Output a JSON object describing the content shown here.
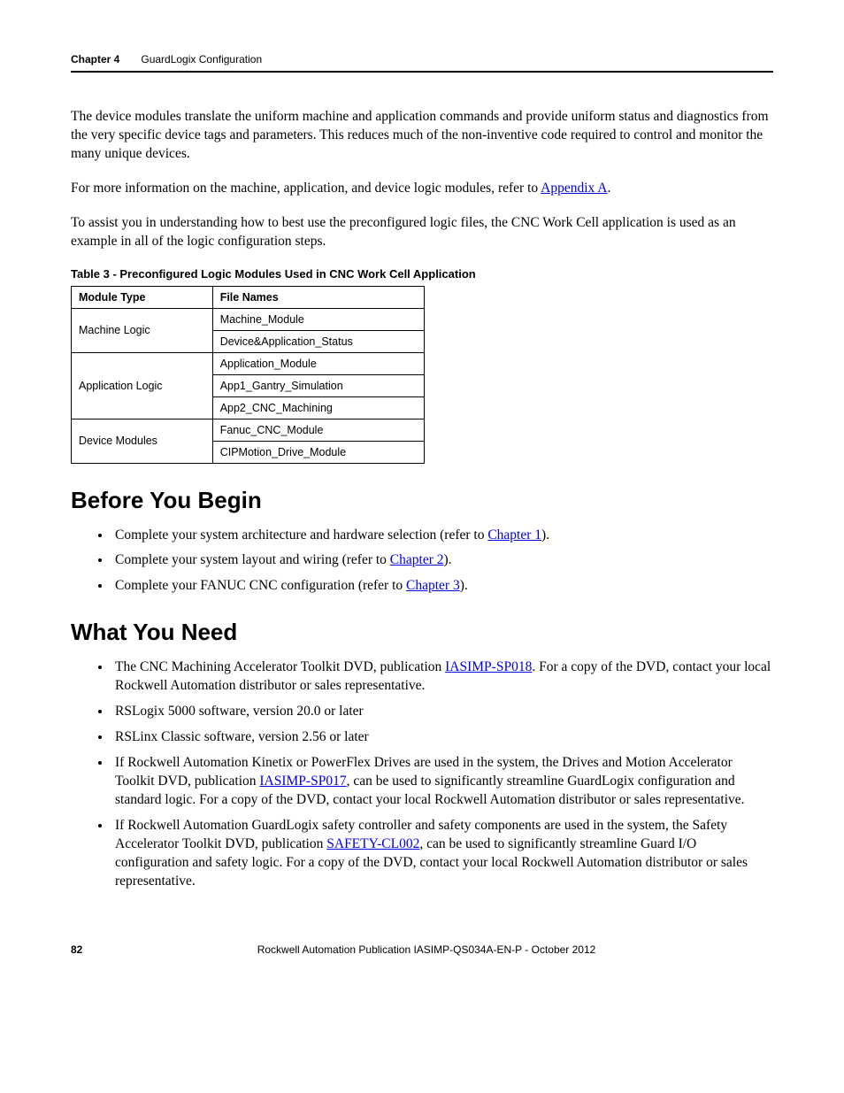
{
  "header": {
    "chapter": "Chapter 4",
    "title": "GuardLogix Configuration"
  },
  "paragraphs": {
    "p1": "The device modules translate the uniform machine and application commands and provide uniform status and diagnostics from the very specific device tags and parameters. This reduces much of the non-inventive code required to control and monitor the many unique devices.",
    "p2_pre": "For more information on the machine, application, and device logic modules, refer to ",
    "p2_link": "Appendix A",
    "p2_post": ".",
    "p3": "To assist you in understanding how to best use the preconfigured logic files, the CNC Work Cell application is used as an example in all of the logic configuration steps."
  },
  "table": {
    "caption": "Table 3 - Preconfigured Logic Modules Used in CNC Work Cell Application",
    "headers": [
      "Module Type",
      "File Names"
    ],
    "rows": [
      {
        "type": "Machine Logic",
        "files": [
          "Machine_Module",
          "Device&Application_Status"
        ]
      },
      {
        "type": "Application Logic",
        "files": [
          "Application_Module",
          "App1_Gantry_Simulation",
          "App2_CNC_Machining"
        ]
      },
      {
        "type": "Device Modules",
        "files": [
          "Fanuc_CNC_Module",
          "CIPMotion_Drive_Module"
        ]
      }
    ]
  },
  "before": {
    "heading": "Before You Begin",
    "items": [
      {
        "pre": "Complete your system architecture and hardware selection (refer to ",
        "link": "Chapter 1",
        "post": ")."
      },
      {
        "pre": "Complete your system layout and wiring (refer to ",
        "link": "Chapter 2",
        "post": ")."
      },
      {
        "pre": "Complete your FANUC CNC configuration (refer to ",
        "link": "Chapter 3",
        "post": ")."
      }
    ]
  },
  "need": {
    "heading": "What You Need",
    "items": [
      {
        "pre": "The CNC Machining Accelerator Toolkit DVD, publication ",
        "link": "IASIMP-SP018",
        "post": ". For a copy of the DVD, contact your local Rockwell Automation distributor or sales representative."
      },
      {
        "pre": "RSLogix 5000 software, version 20.0 or later",
        "link": "",
        "post": ""
      },
      {
        "pre": "RSLinx Classic software, version 2.56 or later",
        "link": "",
        "post": ""
      },
      {
        "pre": "If Rockwell Automation Kinetix or PowerFlex Drives are used in the system, the Drives and Motion Accelerator Toolkit DVD, publication ",
        "link": "IASIMP-SP017",
        "post": ", can be used to significantly streamline GuardLogix configuration and standard logic. For a copy of the DVD, contact your local Rockwell Automation distributor or sales representative."
      },
      {
        "pre": "If Rockwell Automation GuardLogix safety controller and safety components are used in the system, the Safety Accelerator Toolkit DVD, publication ",
        "link": "SAFETY-CL002",
        "post": ", can be used to significantly streamline Guard I/O configuration and safety logic. For a copy of the DVD, contact your local Rockwell Automation distributor or sales representative."
      }
    ]
  },
  "footer": {
    "page": "82",
    "pub_pre": "Rockwell Automation Publication IASIMP-QS034A-EN-P - ",
    "pub_date": "October 2012"
  }
}
